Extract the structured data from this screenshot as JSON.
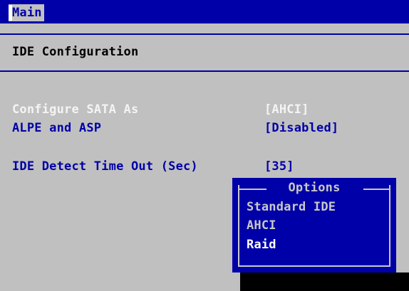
{
  "header": {
    "active_tab": "Main"
  },
  "page": {
    "title": "IDE Configuration"
  },
  "settings": [
    {
      "label": "Configure SATA As",
      "value": "[AHCI]",
      "state": "disabled"
    },
    {
      "label": "ALPE and ASP",
      "value": "[Disabled]",
      "state": "enabled"
    },
    {
      "label": "IDE Detect Time Out (Sec)",
      "value": "[35]",
      "state": "enabled"
    }
  ],
  "options_popup": {
    "title": "Options",
    "items": [
      {
        "label": "Standard IDE",
        "selected": false
      },
      {
        "label": "AHCI",
        "selected": false
      },
      {
        "label": "Raid",
        "selected": true
      }
    ]
  },
  "colors": {
    "background": "#c0c0c0",
    "bios_blue": "#0000a8",
    "disabled_text": "#f4f4f4",
    "selected_text": "#ffffff"
  }
}
